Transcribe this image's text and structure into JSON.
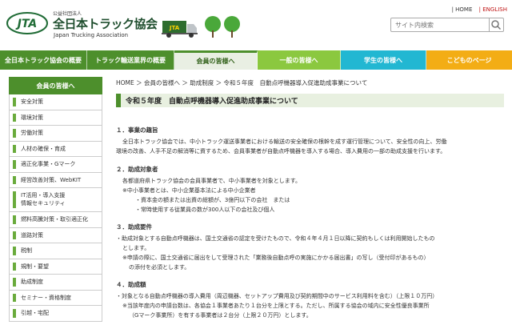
{
  "header": {
    "logo_text": "JTA",
    "org_type": "公益社団法人",
    "org_name": "全日本トラック協会",
    "org_name_en": "Japan Trucking Association",
    "truck_text": "JTA",
    "home_link": "HOME",
    "english_link": "ENGLISH",
    "search_placeholder": "サイト内検索"
  },
  "nav": {
    "items": [
      "全日本トラック協会の概要",
      "トラック輸送業界の概要",
      "会員の皆様へ",
      "一般の皆様へ",
      "学生の皆様へ",
      "こどものページ"
    ]
  },
  "sidebar": {
    "heading": "会員の皆様へ",
    "items": [
      "安全対策",
      "環境対策",
      "労働対策",
      "人材の確保・育成",
      "適正化事業・Gマーク",
      "経営改善対策、WebKIT",
      "IT活用・導入支援\n情報セキュリティ",
      "燃料高騰対策・取引適正化",
      "道路対策",
      "税制",
      "規制・要望",
      "助成制度",
      "セミナー・資格制度",
      "引越・宅配"
    ]
  },
  "breadcrumb": "HOME ＞ 会員の皆様へ ＞ 助成制度 ＞ 令和５年度　自動点呼機器導入促進助成事業について",
  "page_title": "令和５年度　自動点呼機器導入促進助成事業について",
  "sections": {
    "s1": {
      "heading": "１．事業の趣旨",
      "line1": "全日本トラック協会では、中小トラック運送事業者における輸送の安全確保の根幹を成す運行管理について、安全性の向上、労働",
      "line2": "環境の改善、人手不足の解消等に資するため、会員事業者が自動点呼機器を導入する場合、導入費用の一部の助成支援を行います。"
    },
    "s2": {
      "heading": "２．助成対象者",
      "line1": "各都道府県トラック協会の会員事業者で、中小事業者を対象とします。",
      "line2": "※中小事業者とは、中小企業基本法による中小企業者",
      "line3": "・資本金の額または出資の総額が、3億円以下の会社　または",
      "line4": "・常時使用する従業員の数が300人以下の会社及び個人"
    },
    "s3": {
      "heading": "３．助成要件",
      "line1": "・助成対象とする自動点呼機器は、国土交通省の認定を受けたもので、令和４年４月１日以降に契約もしくは利用開始したもの",
      "line2": "とします。",
      "line3": "※申請の際に、国土交通省に届出をして受理された「業務後自動点呼の実施にかかる届出書」の写し（受付印があるもの）",
      "line4": "の添付を必須とします。"
    },
    "s4": {
      "heading": "４．助成額",
      "line1": "・対象となる自動点呼機器の導入費用（周辺機器、セットアップ費用及び契約期間中のサービス利用料を含む）（上限１０万円）",
      "line2": "※当該年度内の申請台数は、各協会１事業者あたり１台分を上限とする。ただし、所属する協会の域内に安全性優良事業所",
      "line3": "（Gマーク事業所）を有する事業者は２台分（上限２０万円）とします。"
    }
  },
  "colors": {
    "brand_green": "#4d8f2c",
    "light_green": "#8bc83f",
    "cyan": "#22b7d2",
    "orange": "#f3ad15",
    "english_red": "#c01717"
  }
}
